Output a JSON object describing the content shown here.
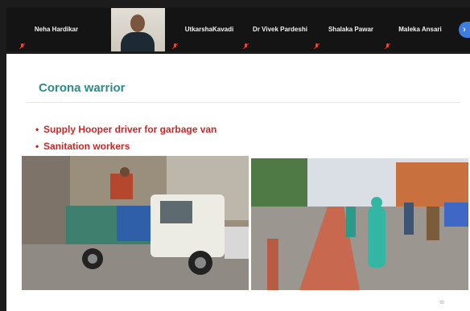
{
  "participants": [
    {
      "name": "Neha Hardikar",
      "muted": true
    },
    {
      "name": "",
      "muted": true,
      "has_video": true
    },
    {
      "name": "UtkarshaKavadi",
      "muted": true
    },
    {
      "name": "Dr Vivek Pardeshi",
      "muted": true
    },
    {
      "name": "Shalaka Pawar",
      "muted": true
    },
    {
      "name": "Maleka Ansari",
      "muted": true
    }
  ],
  "next_button_label": "›",
  "slide": {
    "title": "Corona warrior",
    "bullets": [
      "Supply Hooper driver for garbage van",
      "Sanitation workers"
    ],
    "page_number": "20"
  },
  "colors": {
    "title": "#2e8b8b",
    "bullet": "#c62828",
    "mic_muted": "#e8453c",
    "accent": "#3b7de0"
  }
}
